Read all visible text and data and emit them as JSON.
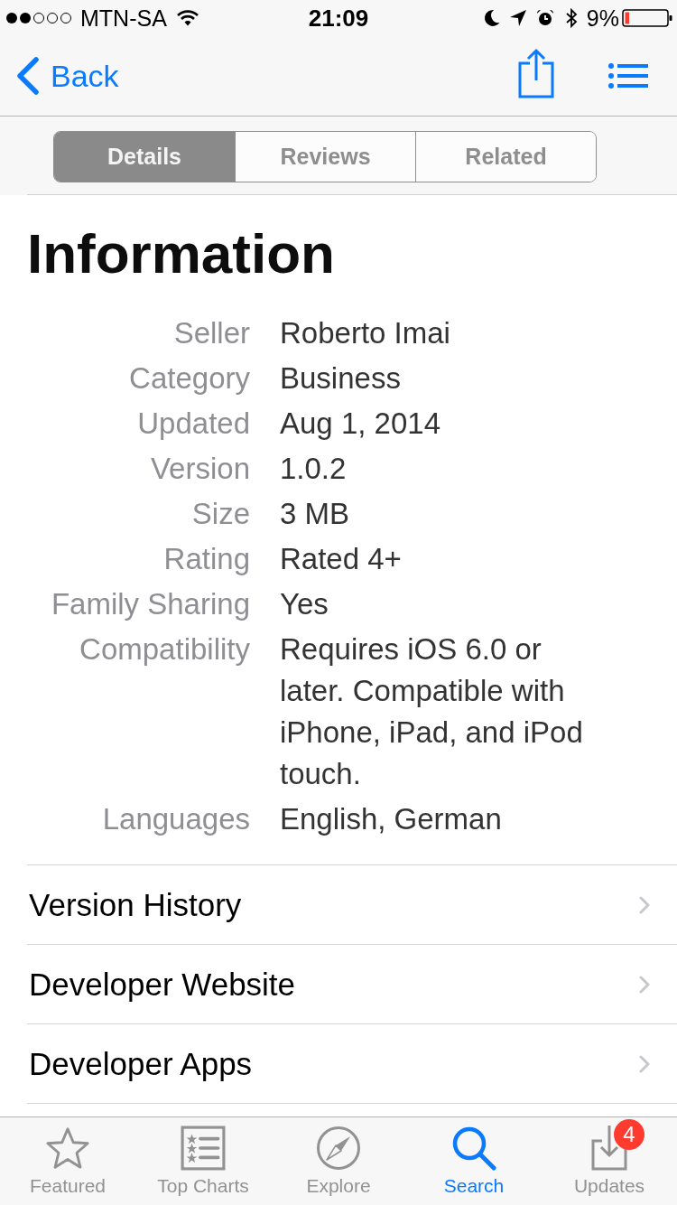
{
  "status_bar": {
    "carrier": "MTN-SA",
    "time": "21:09",
    "battery": "9%"
  },
  "nav_bar": {
    "back": "Back"
  },
  "segments": [
    {
      "label": "Details",
      "selected": true
    },
    {
      "label": "Reviews",
      "selected": false
    },
    {
      "label": "Related",
      "selected": false
    }
  ],
  "information": {
    "title": "Information",
    "rows": [
      {
        "label": "Seller",
        "value": "Roberto Imai"
      },
      {
        "label": "Category",
        "value": "Business"
      },
      {
        "label": "Updated",
        "value": "Aug 1, 2014"
      },
      {
        "label": "Version",
        "value": "1.0.2"
      },
      {
        "label": "Size",
        "value": "3 MB"
      },
      {
        "label": "Rating",
        "value": "Rated 4+"
      },
      {
        "label": "Family Sharing",
        "value": "Yes"
      },
      {
        "label": "Compatibility",
        "value": "Requires iOS 6.0 or later. Compatible with iPhone, iPad, and iPod touch."
      },
      {
        "label": "Languages",
        "value": "English, German"
      }
    ]
  },
  "links": [
    {
      "label": "Version History"
    },
    {
      "label": "Developer Website"
    },
    {
      "label": "Developer Apps"
    }
  ],
  "tab_bar": [
    {
      "kind": "star",
      "label": "Featured",
      "selected": false
    },
    {
      "kind": "charts",
      "label": "Top Charts",
      "selected": false
    },
    {
      "kind": "compass",
      "label": "Explore",
      "selected": false
    },
    {
      "kind": "search",
      "label": "Search",
      "selected": true
    },
    {
      "kind": "updates",
      "label": "Updates",
      "selected": false,
      "badge": "4"
    }
  ]
}
